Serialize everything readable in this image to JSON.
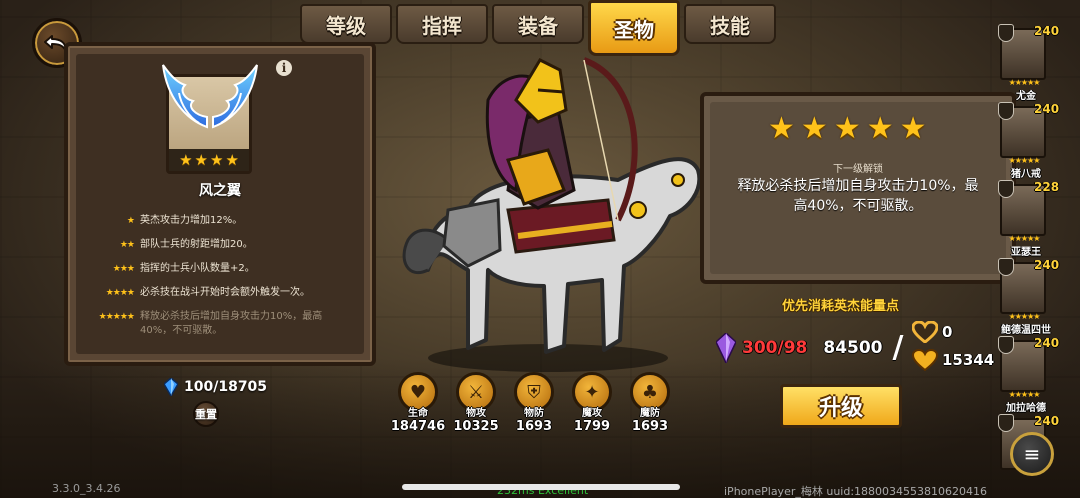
{
  "tabs": [
    {
      "label": "等级"
    },
    {
      "label": "指挥"
    },
    {
      "label": "装备"
    },
    {
      "label": "圣物",
      "active": true
    },
    {
      "label": "技能"
    }
  ],
  "relic": {
    "name": "风之翼",
    "stars": 4,
    "effects": [
      {
        "stars": "★",
        "text": "英杰攻击力增加12%。",
        "locked": false
      },
      {
        "stars": "★★",
        "text": "部队士兵的射距增加20。",
        "locked": false
      },
      {
        "stars": "★★★",
        "text": "指挥的士兵小队数量+2。",
        "locked": false
      },
      {
        "stars": "★★★★",
        "text": "必杀技在战斗开始时会额外触发一次。",
        "locked": false
      },
      {
        "stars": "★★★★★",
        "text": "释放必杀技后增加自身攻击力10%，最高40%，不可驱散。",
        "locked": true
      }
    ]
  },
  "crystals": "100/18705",
  "reset_label": "重置",
  "stats": [
    {
      "label": "生命",
      "value": "184746",
      "icon": "heart-icon",
      "glyph": "♥"
    },
    {
      "label": "物攻",
      "value": "10325",
      "icon": "sword-icon",
      "glyph": "⚔"
    },
    {
      "label": "物防",
      "value": "1693",
      "icon": "shield-icon",
      "glyph": "⛨"
    },
    {
      "label": "魔攻",
      "value": "1799",
      "icon": "magic-icon",
      "glyph": "✦"
    },
    {
      "label": "魔防",
      "value": "1693",
      "icon": "clover-icon",
      "glyph": "♣"
    }
  ],
  "next_unlock": {
    "stars": 5,
    "label": "下一级解锁",
    "desc": "释放必杀技后增加自身攻击力10%，最高40%，不可驱散。"
  },
  "priority_label": "优先消耗英杰能量点",
  "cost": {
    "shards": "300/98",
    "gold": "84500",
    "slash": "/",
    "energy_points": "0",
    "hearts": "15344"
  },
  "upgrade_label": "升级",
  "heroes": [
    {
      "name": "尤金",
      "level": "240"
    },
    {
      "name": "猪八戒",
      "level": "240"
    },
    {
      "name": "亚瑟王",
      "level": "228"
    },
    {
      "name": "鲍德温四世",
      "level": "240"
    },
    {
      "name": "加拉哈德",
      "level": "240"
    },
    {
      "name": "",
      "level": "240"
    }
  ],
  "footer": {
    "version": "3.3.0_3.4.26",
    "fps": "232ms Excellent",
    "device": "iPhonePlayer_梅林 uuid:1880034553810620416"
  },
  "colors": {
    "accent_gold": "#ffc21a",
    "cost_red": "#ff3a3a",
    "priority_yellow": "#ffd33a",
    "fps_green": "#2fbf3a"
  }
}
